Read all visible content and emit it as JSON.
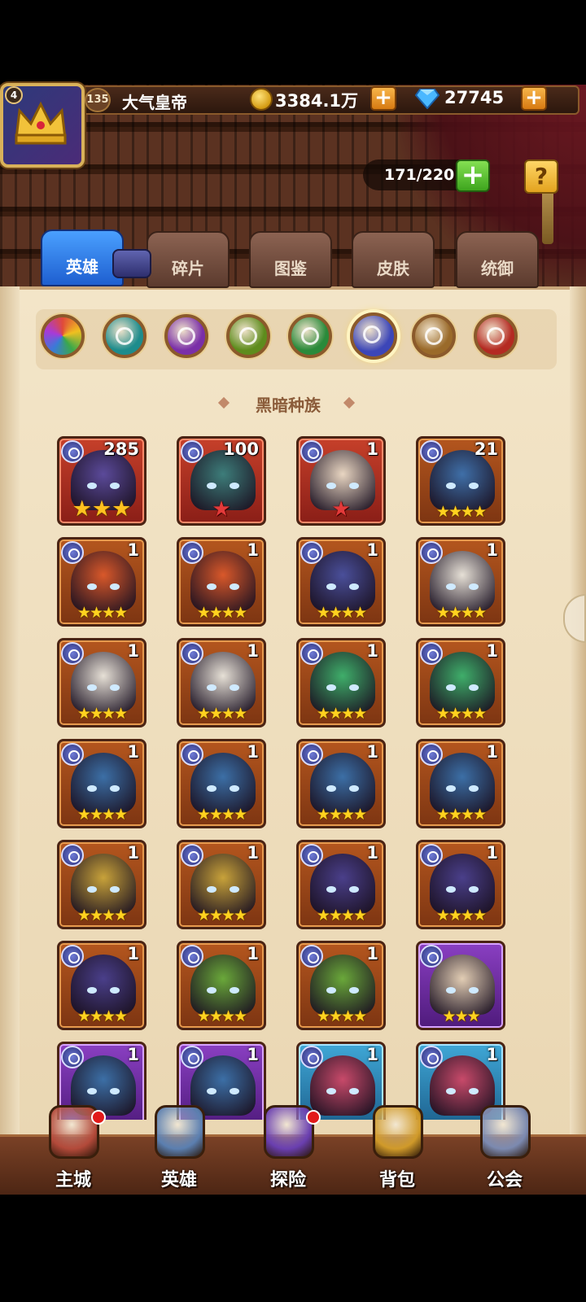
{
  "player": {
    "avatar_level": "4",
    "level": "135",
    "name": "大气皇帝"
  },
  "currencies": {
    "gold": "3384.1万",
    "gems": "27745"
  },
  "capacity": "171/220",
  "help_label": "?",
  "tabs": [
    {
      "label": "英雄",
      "active": true
    },
    {
      "label": "碎片",
      "active": false
    },
    {
      "label": "图鉴",
      "active": false
    },
    {
      "label": "皮肤",
      "active": false
    },
    {
      "label": "统御",
      "active": false
    }
  ],
  "race_filters": [
    {
      "name": "all-races",
      "color": "#e04a3a",
      "selected": false
    },
    {
      "name": "race-teal",
      "color": "#1d8c8c",
      "selected": false
    },
    {
      "name": "race-purple",
      "color": "#7a2fa8",
      "selected": false
    },
    {
      "name": "race-green-eye",
      "color": "#5e8c1d",
      "selected": false
    },
    {
      "name": "race-leaf",
      "color": "#2a8a3a",
      "selected": false
    },
    {
      "name": "race-dark",
      "color": "#3c46b8",
      "selected": true
    },
    {
      "name": "race-light",
      "color": "#9a6a2a",
      "selected": false
    },
    {
      "name": "race-red",
      "color": "#b42a22",
      "selected": false
    }
  ],
  "section_title": "黑暗种族",
  "heroes": [
    {
      "level": "285",
      "stars": 3,
      "star_style": "gold3",
      "quality": "red",
      "skin": "#5b4a9a"
    },
    {
      "level": "100",
      "stars": 1,
      "star_style": "red1",
      "quality": "red",
      "skin": "#3d7d7a"
    },
    {
      "level": "1",
      "stars": 1,
      "star_style": "red1",
      "quality": "red",
      "skin": "#e9d6c2"
    },
    {
      "level": "21",
      "stars": 4,
      "star_style": "s4",
      "quality": "orange",
      "skin": "#3f6fa8"
    },
    {
      "level": "1",
      "stars": 4,
      "star_style": "s4",
      "quality": "orange",
      "skin": "#d9582a"
    },
    {
      "level": "1",
      "stars": 4,
      "star_style": "s4",
      "quality": "orange",
      "skin": "#d9582a"
    },
    {
      "level": "1",
      "stars": 4,
      "star_style": "s4",
      "quality": "orange",
      "skin": "#4a4f9a"
    },
    {
      "level": "1",
      "stars": 4,
      "star_style": "s4",
      "quality": "orange",
      "skin": "#e6e0d6"
    },
    {
      "level": "1",
      "stars": 4,
      "star_style": "s4",
      "quality": "orange",
      "skin": "#e6e0d6"
    },
    {
      "level": "1",
      "stars": 4,
      "star_style": "s4",
      "quality": "orange",
      "skin": "#e6e0d6"
    },
    {
      "level": "1",
      "stars": 4,
      "star_style": "s4",
      "quality": "orange",
      "skin": "#3fae6a"
    },
    {
      "level": "1",
      "stars": 4,
      "star_style": "s4",
      "quality": "orange",
      "skin": "#3fae6a"
    },
    {
      "level": "1",
      "stars": 4,
      "star_style": "s4",
      "quality": "orange",
      "skin": "#3c6fa6"
    },
    {
      "level": "1",
      "stars": 4,
      "star_style": "s4",
      "quality": "orange",
      "skin": "#3c6fa6"
    },
    {
      "level": "1",
      "stars": 4,
      "star_style": "s4",
      "quality": "orange",
      "skin": "#3c6fa6"
    },
    {
      "level": "1",
      "stars": 4,
      "star_style": "s4",
      "quality": "orange",
      "skin": "#3c6fa6"
    },
    {
      "level": "1",
      "stars": 4,
      "star_style": "s4",
      "quality": "orange",
      "skin": "#c8a23a"
    },
    {
      "level": "1",
      "stars": 4,
      "star_style": "s4",
      "quality": "orange",
      "skin": "#c8a23a"
    },
    {
      "level": "1",
      "stars": 4,
      "star_style": "s4",
      "quality": "orange",
      "skin": "#4a3f8a"
    },
    {
      "level": "1",
      "stars": 4,
      "star_style": "s4",
      "quality": "orange",
      "skin": "#4a3f8a"
    },
    {
      "level": "1",
      "stars": 4,
      "star_style": "s4",
      "quality": "orange",
      "skin": "#4a3f8a"
    },
    {
      "level": "1",
      "stars": 4,
      "star_style": "s4",
      "quality": "orange",
      "skin": "#6aa83a"
    },
    {
      "level": "1",
      "stars": 4,
      "star_style": "s4",
      "quality": "orange",
      "skin": "#6aa83a"
    },
    {
      "level": "",
      "stars": 3,
      "star_style": "gold3s",
      "quality": "purple",
      "skin": "#e2cdb4"
    },
    {
      "level": "1",
      "stars": 0,
      "star_style": "none",
      "quality": "purple",
      "skin": "#3c6fa6"
    },
    {
      "level": "1",
      "stars": 0,
      "star_style": "none",
      "quality": "purple",
      "skin": "#3c6fa6"
    },
    {
      "level": "1",
      "stars": 0,
      "star_style": "none",
      "quality": "blue",
      "skin": "#c84a6a"
    },
    {
      "level": "1",
      "stars": 0,
      "star_style": "none",
      "quality": "blue",
      "skin": "#c84a6a"
    }
  ],
  "bottom_nav": [
    {
      "label": "主城",
      "icon": "castle-icon",
      "color": "#b34a3a",
      "dot": true
    },
    {
      "label": "英雄",
      "icon": "hero-portrait-icon",
      "color": "#5b7fb0",
      "dot": false
    },
    {
      "label": "探险",
      "icon": "portal-icon",
      "color": "#6a3fb0",
      "dot": true
    },
    {
      "label": "背包",
      "icon": "backpack-icon",
      "color": "#d09a2a",
      "dot": false
    },
    {
      "label": "公会",
      "icon": "guild-tower-icon",
      "color": "#7c8ab0",
      "dot": false
    }
  ]
}
